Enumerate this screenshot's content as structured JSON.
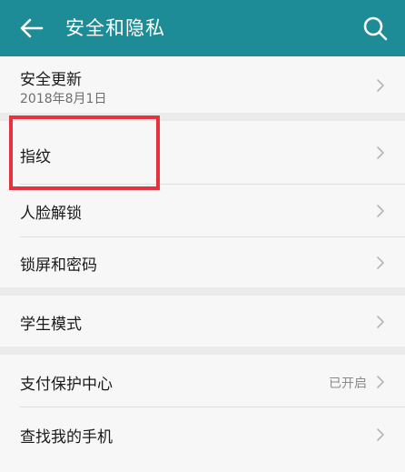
{
  "header": {
    "back_icon": "arrow-left-icon",
    "title": "安全和隐私",
    "search_icon": "search-icon",
    "background_color": "#1d8c96"
  },
  "items": [
    {
      "id": "security-update",
      "label": "安全更新",
      "sub": "2018年8月1日",
      "status": ""
    },
    {
      "id": "fingerprint",
      "label": "指纹",
      "sub": "",
      "status": ""
    },
    {
      "id": "face-unlock",
      "label": "人脸解锁",
      "sub": "",
      "status": ""
    },
    {
      "id": "lock-screen-password",
      "label": "锁屏和密码",
      "sub": "",
      "status": ""
    },
    {
      "id": "student-mode",
      "label": "学生模式",
      "sub": "",
      "status": ""
    },
    {
      "id": "payment-protection",
      "label": "支付保护中心",
      "sub": "",
      "status": "已开启"
    },
    {
      "id": "find-my-phone",
      "label": "查找我的手机",
      "sub": "",
      "status": ""
    }
  ],
  "annotation": {
    "highlight_color": "#e6323c",
    "highlighted_item": "指纹"
  }
}
